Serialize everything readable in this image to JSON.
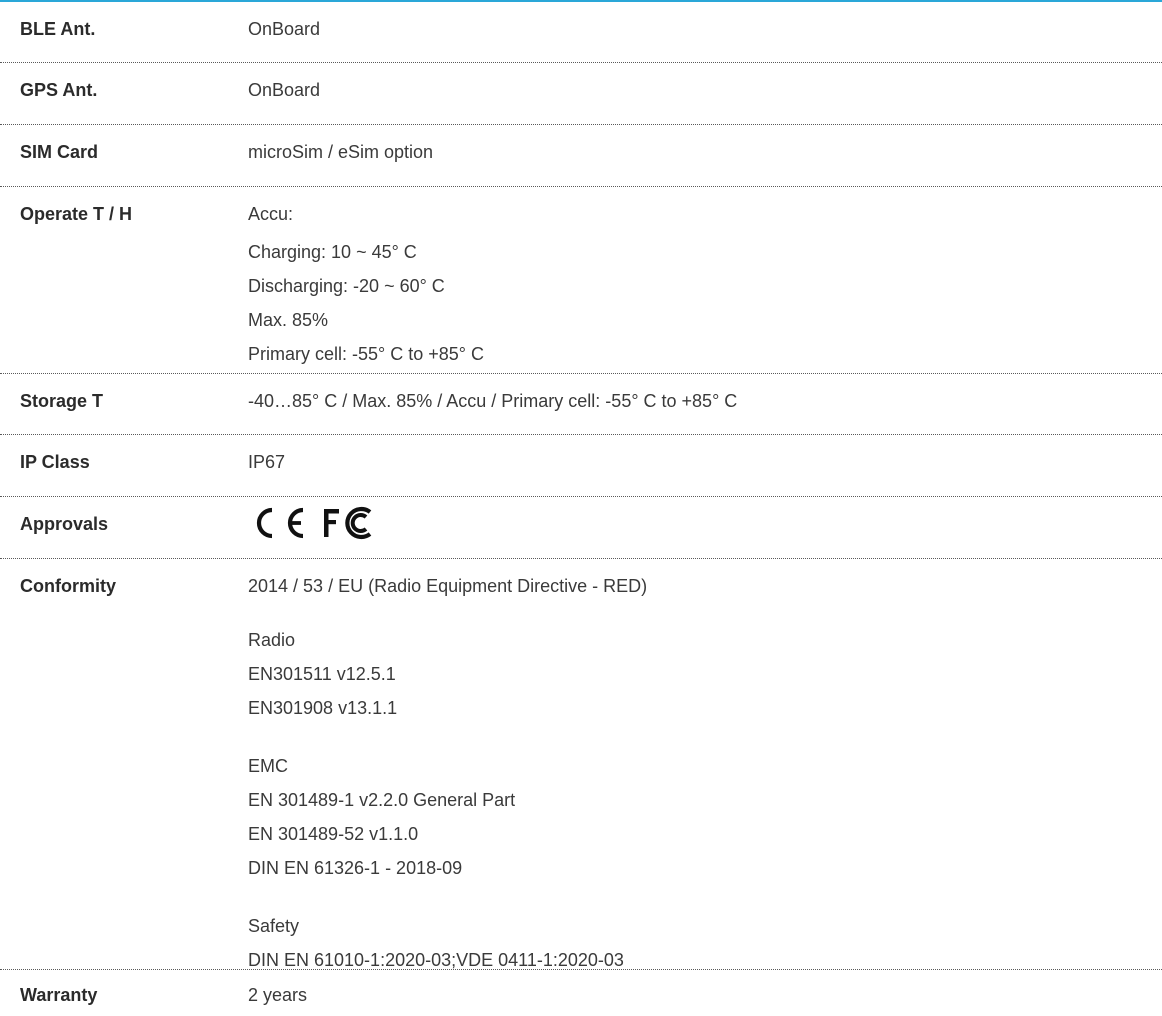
{
  "accent_color": "#2aa7d8",
  "rows": [
    {
      "label": "BLE Ant.",
      "value": "OnBoard"
    },
    {
      "label": "GPS Ant.",
      "value": "OnBoard"
    },
    {
      "label": "SIM Card",
      "value": "microSim / eSim option"
    },
    {
      "label": "Operate T / H",
      "lines": [
        "Accu:",
        "Charging: 10 ~ 45° C",
        "Discharging: -20 ~ 60° C",
        "Max. 85%",
        "Primary cell: -55° C to +85° C"
      ]
    },
    {
      "label": "Storage T",
      "value": "-40…85° C / Max. 85% / Accu / Primary cell: -55° C to +85° C"
    },
    {
      "label": "IP Class",
      "value": "IP67"
    },
    {
      "label": "Approvals",
      "icons": [
        "ce-mark-icon",
        "fcc-logo-icon"
      ],
      "icon_labels": [
        "CE",
        "FC"
      ]
    },
    {
      "label": "Conformity",
      "groups": [
        [
          "2014 / 53 / EU (Radio Equipment Directive - RED)"
        ],
        [
          "Radio",
          "EN301511 v12.5.1",
          "EN301908 v13.1.1"
        ],
        [
          "EMC",
          "EN 301489-1 v2.2.0 General Part",
          "EN 301489-52 v1.1.0",
          "DIN EN 61326-1 - 2018-09"
        ],
        [
          "Safety",
          "DIN EN 61010-1:2020-03;VDE 0411-1:2020-03"
        ]
      ]
    },
    {
      "label": "Warranty",
      "value": "2 years"
    }
  ]
}
